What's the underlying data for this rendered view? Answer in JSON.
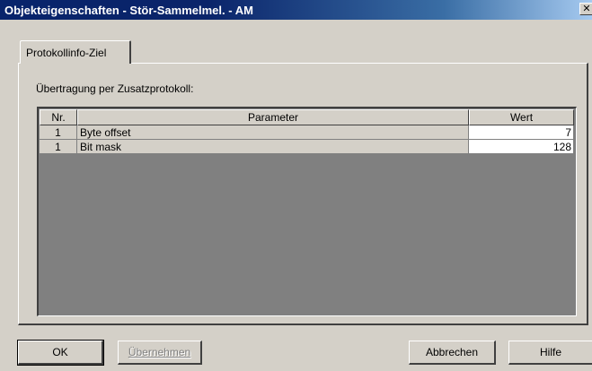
{
  "window": {
    "title": "Objekteigenschaften - Stör-Sammelmel. - AM",
    "close_glyph": "✕"
  },
  "tabs": [
    {
      "label": "Protokollinfo-Ziel",
      "selected": true
    }
  ],
  "section": {
    "label": "Übertragung per Zusatzprotokoll:"
  },
  "table": {
    "columns": [
      "Nr.",
      "Parameter",
      "Wert"
    ],
    "rows": [
      {
        "nr": "1",
        "parameter": "Byte offset",
        "wert": "7"
      },
      {
        "nr": "1",
        "parameter": "Bit mask",
        "wert": "128"
      }
    ]
  },
  "buttons": {
    "ok": "OK",
    "apply": "Übernehmen",
    "cancel": "Abbrechen",
    "help": "Hilfe"
  },
  "colors": {
    "titlebar_start": "#08246b",
    "titlebar_end": "#a6caf0",
    "dialog_bg": "#d4d0c8",
    "grid_empty": "#808080"
  }
}
